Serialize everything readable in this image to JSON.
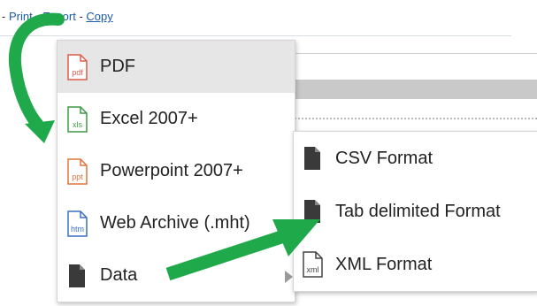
{
  "toplinks": {
    "sep1": "- ",
    "print": "Print",
    "sep2": " - ",
    "export": "Export",
    "sep3": " - ",
    "copy": "Copy"
  },
  "menu": {
    "items": [
      {
        "label": "PDF",
        "icon": "pdf-file-icon",
        "highlighted": true
      },
      {
        "label": "Excel 2007+",
        "icon": "xls-file-icon"
      },
      {
        "label": "Powerpoint 2007+",
        "icon": "ppt-file-icon"
      },
      {
        "label": "Web Archive (.mht)",
        "icon": "htm-file-icon"
      },
      {
        "label": "Data",
        "icon": "document-icon",
        "has_submenu": true
      }
    ]
  },
  "submenu": {
    "items": [
      {
        "label": "CSV Format",
        "icon": "document-icon"
      },
      {
        "label": "Tab delimited Format",
        "icon": "document-icon"
      },
      {
        "label": "XML Format",
        "icon": "xml-file-icon"
      }
    ]
  },
  "colors": {
    "link": "#1a5aa8",
    "highlight": "#e6e6e6",
    "pdf": "#e05a4a",
    "xls": "#3f9a46",
    "ppt": "#e0733c",
    "htm": "#3a6fc4",
    "annotation_arrow": "#1fa94a"
  },
  "icons": {
    "pdf_text": "pdf",
    "xls_text": "xls",
    "ppt_text": "ppt",
    "htm_text": "htm",
    "xml_text": "xml"
  }
}
